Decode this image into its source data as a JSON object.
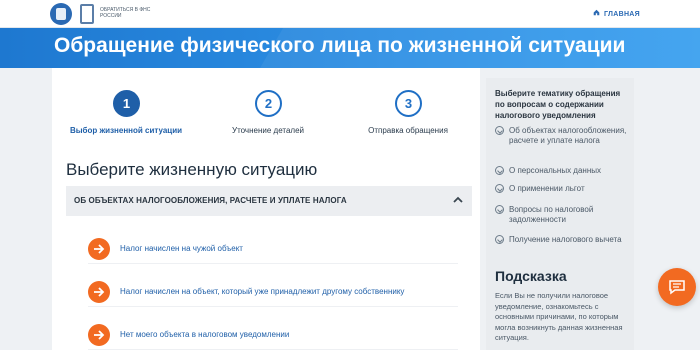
{
  "header": {
    "logo_text": "Обратиться в ФНС России",
    "home_label": "ГЛАВНАЯ"
  },
  "hero": {
    "title": "Обращение физического лица по жизненной ситуации"
  },
  "steps": [
    {
      "number": "1",
      "label": "Выбор жизненной ситуации",
      "active": true
    },
    {
      "number": "2",
      "label": "Уточнение деталей",
      "active": false
    },
    {
      "number": "3",
      "label": "Отправка обращения",
      "active": false
    }
  ],
  "main": {
    "heading": "Выберите жизненную ситуацию",
    "accordion": {
      "title": "ОБ ОБЪЕКТАХ НАЛОГООБЛОЖЕНИЯ, РАСЧЕТЕ И УПЛАТЕ НАЛОГА",
      "items": [
        "Налог начислен на чужой объект",
        "Налог начислен на объект, который уже принадлежит другому собственнику",
        "Нет моего объекта в налоговом уведомлении"
      ]
    }
  },
  "sidebar": {
    "title": "Выберите тематику обращения по вопросам о содержании налогового уведомления",
    "topics": [
      "Об объектах налогообложения, расчете и уплате налога",
      "О персональных данных",
      "О применении льгот",
      "Вопросы по налоговой задолженности",
      "Получение налогового вычета"
    ],
    "hint_title": "Подсказка",
    "hint_text": "Если Вы не получили налоговое уведомление, ознакомьтесь с основными причинами, по которым могла возникнуть данная жизненная ситуация."
  },
  "colors": {
    "accent": "#1f5fa8",
    "orange": "#f26a21",
    "hero": "#2d8fe4"
  }
}
